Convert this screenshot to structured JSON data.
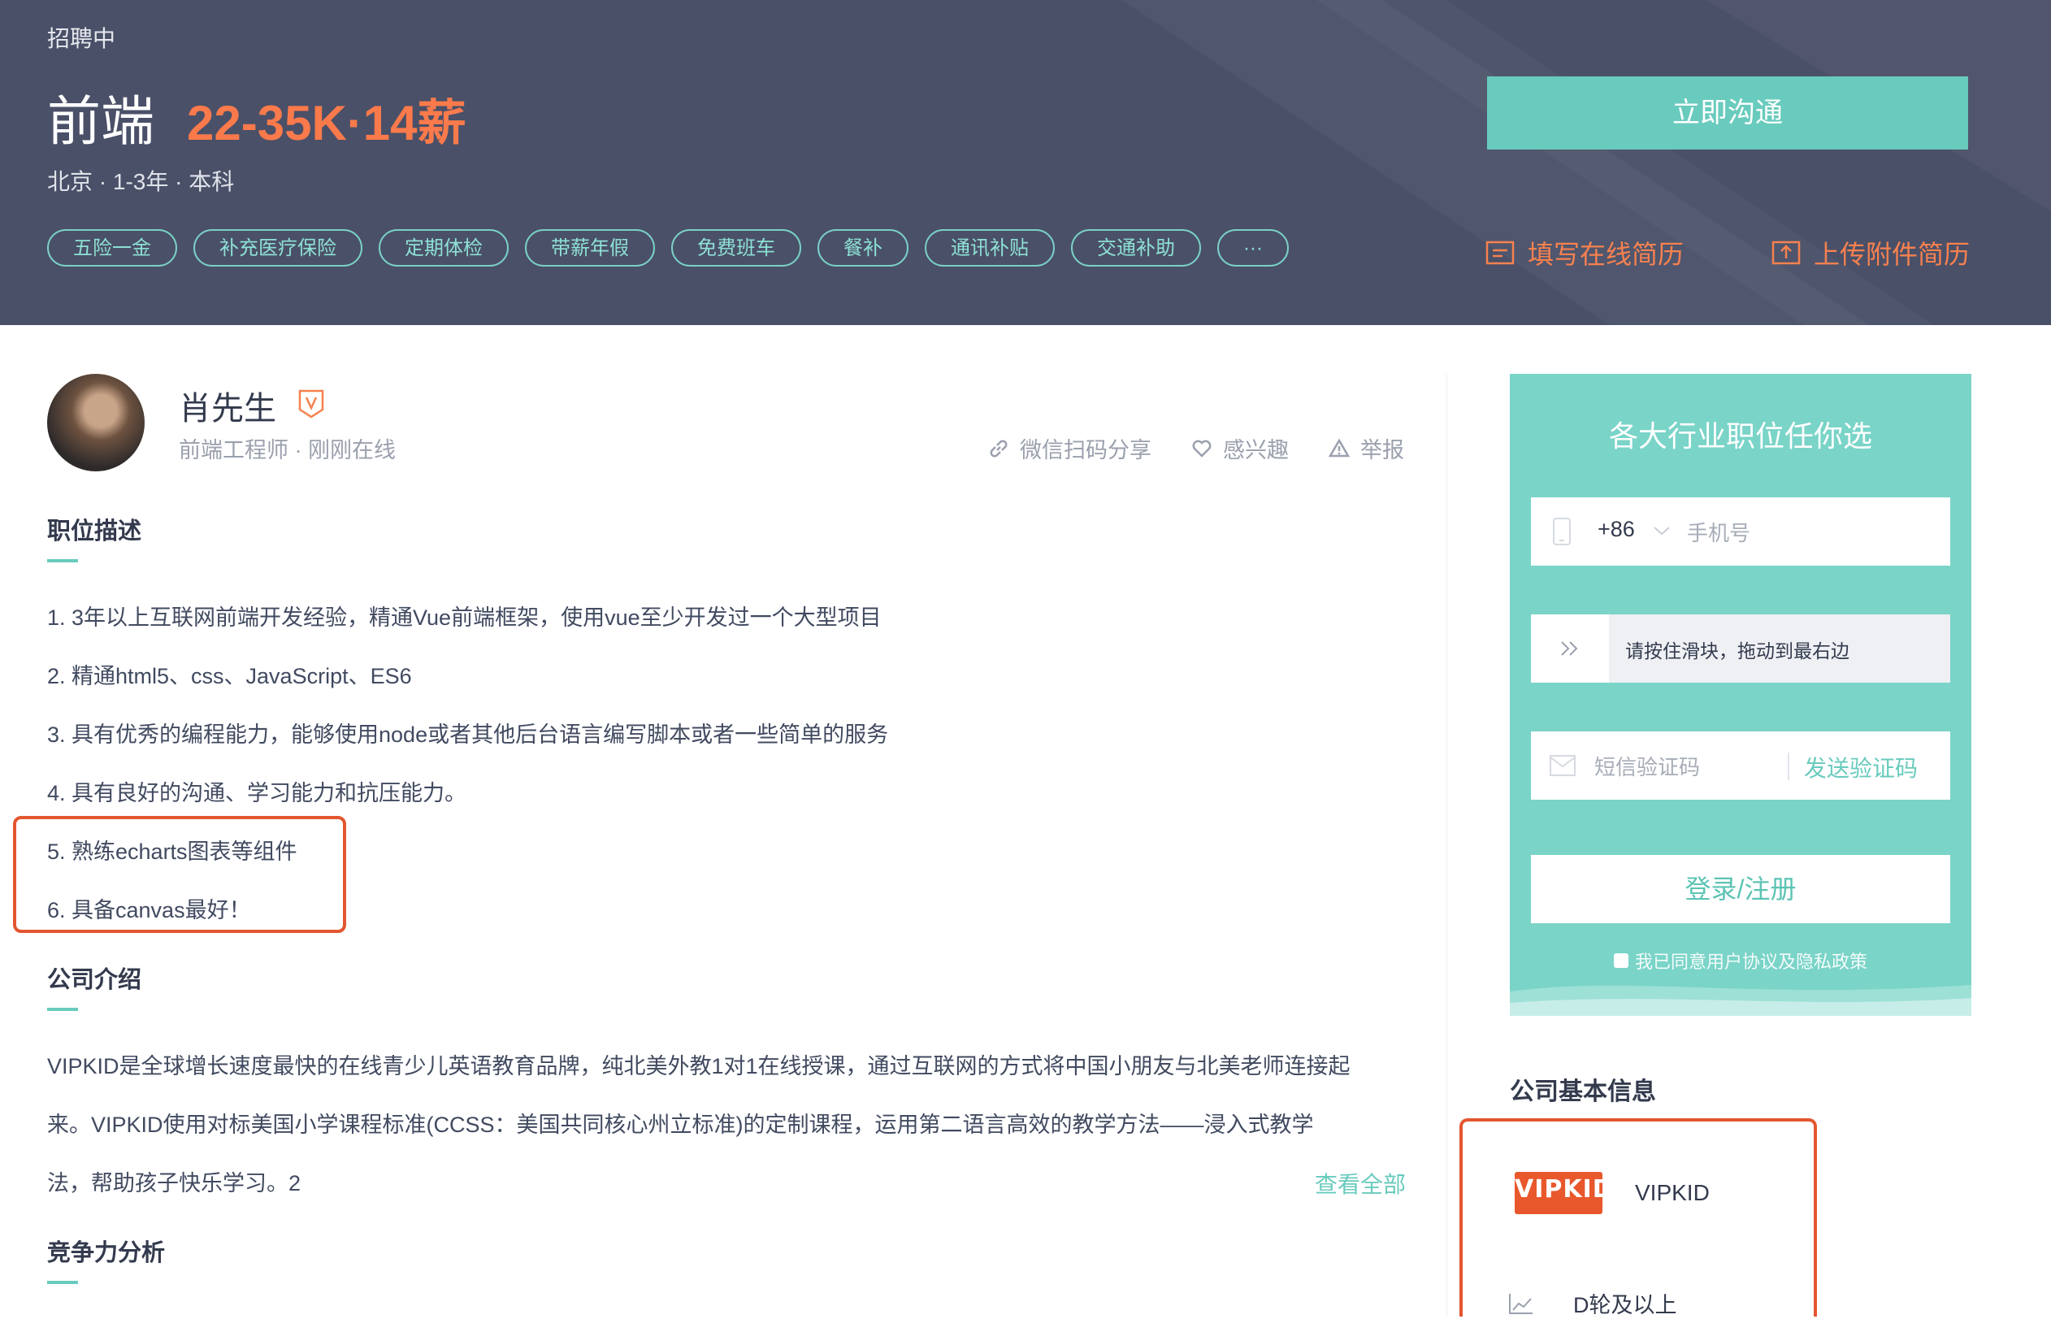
{
  "header": {
    "status": "招聘中",
    "job_title": "前端",
    "salary": "22-35K·14薪",
    "meta": "北京 · 1-3年 · 本科",
    "tags": [
      "五险一金",
      "补充医疗保险",
      "定期体检",
      "带薪年假",
      "免费班车",
      "餐补",
      "通讯补贴",
      "交通补助",
      "···"
    ],
    "chat_button": "立即沟通",
    "fill_resume": "填写在线简历",
    "upload_resume": "上传附件简历"
  },
  "recruiter": {
    "name": "肖先生",
    "title_status": "前端工程师 · 刚刚在线",
    "share": "微信扫码分享",
    "interest": "感兴趣",
    "report": "举报"
  },
  "job_description": {
    "heading": "职位描述",
    "lines": [
      "1. 3年以上互联网前端开发经验，精通Vue前端框架，使用vue至少开发过一个大型项目",
      "2. 精通html5、css、JavaScript、ES6",
      "3. 具有优秀的编程能力，能够使用node或者其他后台语言编写脚本或者一些简单的服务",
      "4. 具有良好的沟通、学习能力和抗压能力。",
      "5. 熟练echarts图表等组件",
      "6. 具备canvas最好！"
    ]
  },
  "company_intro": {
    "heading": "公司介绍",
    "lines": [
      "VIPKID是全球增长速度最快的在线青少儿英语教育品牌，纯北美外教1对1在线授课，通过互联网的方式将中国小朋友与北美老师连接起",
      "来。VIPKID使用对标美国小学课程标准(CCSS：美国共同核心州立标准)的定制课程，运用第二语言高效的教学方法——浸入式教学",
      "法，帮助孩子快乐学习。2"
    ],
    "view_all": "查看全部"
  },
  "competitiveness": {
    "heading": "竞争力分析"
  },
  "login_card": {
    "title": "各大行业职位任你选",
    "country_code": "+86",
    "phone_placeholder": "手机号",
    "slider_hint": "请按住滑块，拖动到最右边",
    "sms_placeholder": "短信验证码",
    "send_code": "发送验证码",
    "login_button": "登录/注册",
    "agreement": "我已同意用户协议及隐私政策"
  },
  "company_info": {
    "heading": "公司基本信息",
    "logo_text": "VIPKID",
    "name": "VIPKID",
    "funding": "D轮及以上"
  },
  "colors": {
    "banner": "#4a5068",
    "accent": "#69cbbd",
    "salary": "#fa7a4b",
    "highlight": "#e3562f"
  }
}
